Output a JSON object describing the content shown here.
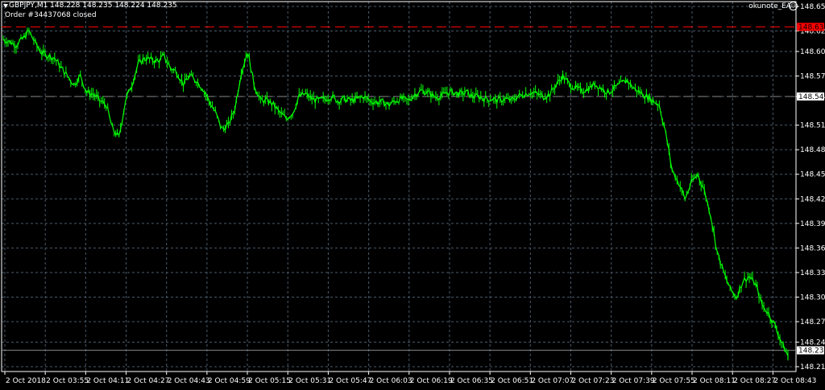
{
  "header": {
    "symbol_info": "GBPJPY,M1  148.228 148.235 148.224 148.235",
    "order_info": "Order #34437068 closed",
    "ea_name": "okunote_EA",
    "ea_icon": "smiley-icon"
  },
  "colors": {
    "background": "#000000",
    "grid": "#4a5a6a",
    "candle": "#00ff00",
    "axis": "#ffffff",
    "red_line": "#ff0000",
    "gray_line": "#8a8a8a",
    "red_label_bg": "#ff0000",
    "label_bg": "#ffffff",
    "label_text": "#000000"
  },
  "chart_data": {
    "type": "line",
    "ylim": [
      148.215,
      148.655
    ],
    "y_ticks": [
      "148.655",
      "148.625",
      "148.600",
      "148.570",
      "148.545",
      "148.510",
      "148.480",
      "148.450",
      "148.420",
      "148.390",
      "148.360",
      "148.330",
      "148.300",
      "148.270",
      "148.245",
      "148.215"
    ],
    "x_ticks": [
      "2 Oct 2018",
      "2 Oct 03:55",
      "2 Oct 04:11",
      "2 Oct 04:27",
      "2 Oct 04:43",
      "2 Oct 04:59",
      "2 Oct 05:15",
      "2 Oct 05:31",
      "2 Oct 05:47",
      "2 Oct 06:03",
      "2 Oct 06:19",
      "2 Oct 06:35",
      "2 Oct 06:51",
      "2 Oct 07:07",
      "2 Oct 07:23",
      "2 Oct 07:39",
      "2 Oct 07:55",
      "2 Oct 08:11",
      "2 Oct 08:27",
      "2 Oct 08:43"
    ],
    "price_lines": [
      {
        "label": "148.630",
        "value": 148.63,
        "style": "dashed",
        "color": "#ff0000"
      },
      {
        "label": "148.545",
        "value": 148.545,
        "style": "dashed",
        "color": "#8a8a8a"
      },
      {
        "label": "148.235",
        "value": 148.235,
        "style": "solid",
        "color": "#8a8a8a"
      }
    ],
    "series": [
      {
        "x": [
          0,
          8,
          16,
          24,
          32,
          40,
          48,
          56,
          64,
          72,
          80,
          88,
          96,
          104,
          112,
          120,
          128,
          136,
          144,
          152,
          160,
          168,
          176,
          184,
          192,
          200,
          208,
          216,
          224,
          232,
          240,
          248,
          256,
          264,
          272,
          280,
          288,
          296,
          304,
          312,
          320,
          328,
          336,
          344,
          352,
          360,
          368,
          376,
          384,
          392,
          400,
          408,
          416,
          424,
          432,
          440,
          448,
          456,
          464,
          472,
          480,
          488,
          496,
          504,
          512,
          520,
          528,
          536,
          544,
          552,
          560,
          568,
          576,
          584,
          592,
          600,
          608,
          616,
          624,
          632,
          640,
          648,
          656,
          664,
          672,
          680,
          688,
          696,
          704,
          712,
          720,
          728,
          736,
          744,
          752,
          760,
          768,
          776,
          784,
          792,
          800,
          808,
          816,
          824,
          832,
          840,
          848,
          856,
          864,
          872,
          880,
          888,
          896,
          904,
          912,
          920,
          928,
          936,
          944,
          952,
          960,
          968,
          976
        ],
        "values": [
          148.615,
          148.612,
          148.608,
          148.615,
          148.625,
          148.61,
          148.598,
          148.595,
          148.592,
          148.58,
          148.57,
          148.56,
          148.57,
          148.55,
          148.548,
          148.54,
          148.535,
          148.505,
          148.495,
          148.54,
          148.56,
          148.585,
          148.592,
          148.59,
          148.588,
          148.594,
          148.58,
          148.575,
          148.56,
          148.57,
          148.565,
          148.555,
          148.54,
          148.525,
          148.505,
          148.51,
          148.53,
          148.575,
          148.6,
          148.56,
          148.54,
          148.54,
          148.535,
          148.525,
          148.518,
          148.525,
          148.545,
          148.548,
          148.542,
          148.54,
          148.542,
          148.545,
          148.54,
          148.542,
          148.54,
          148.542,
          148.545,
          148.54,
          148.538,
          148.538,
          148.535,
          148.54,
          148.542,
          148.54,
          148.548,
          148.552,
          148.55,
          148.545,
          148.545,
          148.55,
          148.55,
          148.548,
          148.55,
          148.545,
          148.545,
          148.542,
          148.542,
          148.54,
          148.542,
          148.54,
          148.545,
          148.548,
          148.55,
          148.548,
          148.545,
          148.548,
          148.56,
          148.57,
          148.56,
          148.555,
          148.552,
          148.555,
          148.56,
          148.555,
          148.55,
          148.555,
          148.56,
          148.565,
          148.555,
          148.55,
          148.545,
          148.54,
          148.535,
          148.5,
          148.455,
          148.44,
          148.42,
          148.44,
          148.45,
          148.43,
          148.4,
          148.355,
          148.33,
          148.31,
          148.3,
          148.32,
          148.325,
          148.315,
          148.29,
          148.28,
          148.265,
          148.245,
          148.228
        ]
      }
    ]
  }
}
